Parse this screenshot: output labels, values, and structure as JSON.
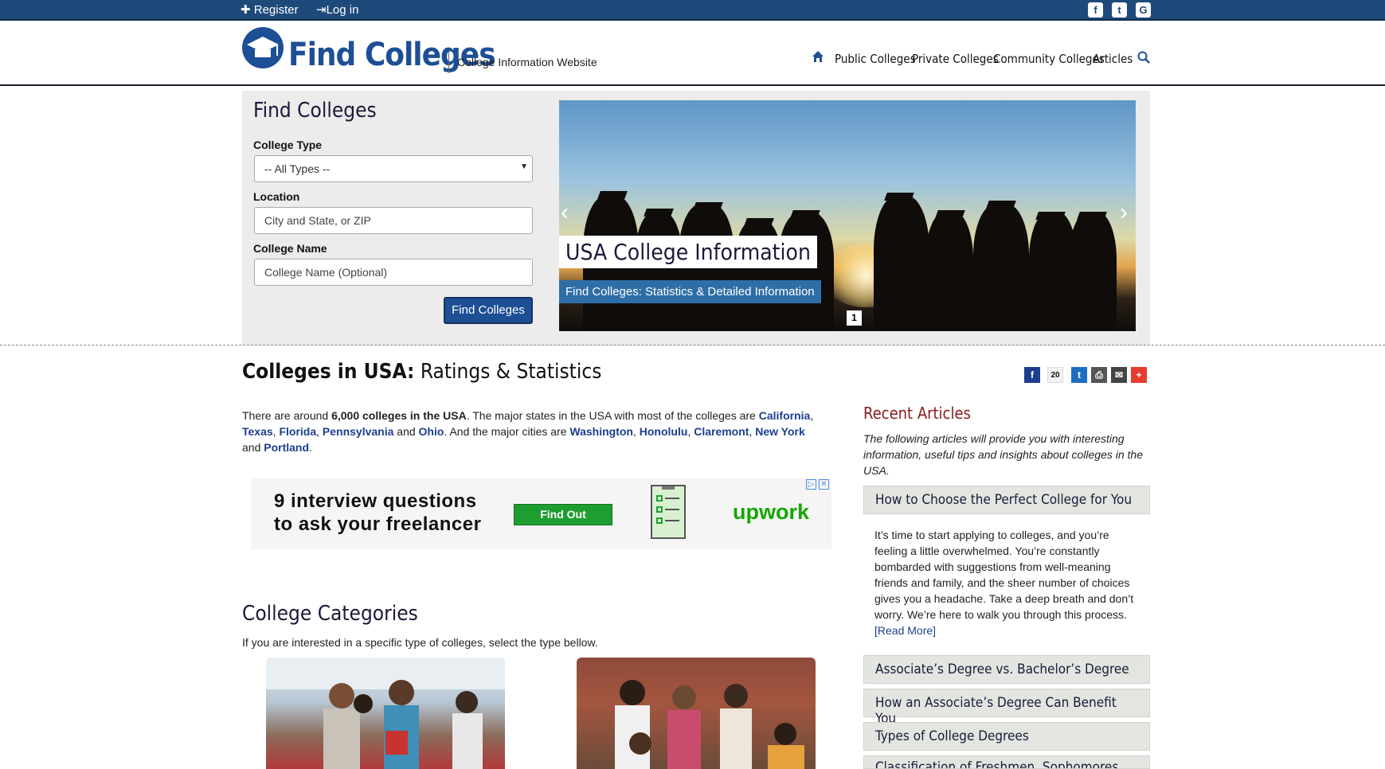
{
  "topbar": {
    "register": "Register",
    "login": "Log in"
  },
  "header": {
    "logo": "Find Colleges",
    "tagline": "College Information Website",
    "nav": [
      "Public Colleges",
      "Private Colleges",
      "Community Colleges",
      "Articles"
    ]
  },
  "search_form": {
    "title": "Find Colleges",
    "type_label": "College Type",
    "type_value": "-- All Types --",
    "location_label": "Location",
    "location_placeholder": "City and State, or ZIP",
    "name_label": "College Name",
    "name_placeholder": "College Name (Optional)",
    "button": "Find Colleges"
  },
  "slider": {
    "title": "USA College Information",
    "subtitle": "Find Colleges: Statistics & Detailed Information",
    "page": "1"
  },
  "main": {
    "heading_bold": "Colleges in USA:",
    "heading_rest": " Ratings & Statistics",
    "share_count": "20",
    "intro": {
      "t1": "There are around ",
      "b1": "6,000 colleges in the USA",
      "t2": ". The major states in the USA with most of the colleges are ",
      "s1": "California",
      "s2": "Texas",
      "s3": "Florida",
      "s4": "Pennsylvania",
      "t_and1": " and ",
      "s5": "Ohio",
      "t3": ". And the major cities are ",
      "c1": "Washington",
      "c2": "Honolulu",
      "c3": "Claremont",
      "c4": "New York",
      "t_and2": " and ",
      "c5": "Portland",
      "comma": ", ",
      "period": "."
    },
    "ad": {
      "line1": "9 interview questions",
      "line2": "to ask your freelancer",
      "button": "Find Out",
      "brand": "upwork"
    },
    "categories_title": "College Categories",
    "categories_sub": "If you are interested in a specific type of colleges, select the type bellow."
  },
  "sidebar": {
    "title": "Recent Articles",
    "desc": "The following articles will provide you with interesting information, useful tips and insights about colleges in the USA.",
    "articles": [
      "How to Choose the Perfect College for You",
      "Associate’s Degree vs. Bachelor’s Degree",
      "How an Associate’s Degree Can Benefit You",
      "Types of College Degrees",
      "Classification of Freshmen, Sophomores, Juniors"
    ],
    "first_body": "It’s time to start applying to colleges, and you’re feeling a little overwhelmed. You’re constantly bombarded with suggestions from well-meaning friends and family, and the sheer number of choices gives you a headache. Take a deep breath and don’t worry. We’re here to walk you through this process.",
    "read_more": "[Read More]"
  },
  "colors": {
    "brand_blue": "#1d4f95",
    "topbar": "#1d4a7a",
    "article_title": "#8b1a1a"
  }
}
